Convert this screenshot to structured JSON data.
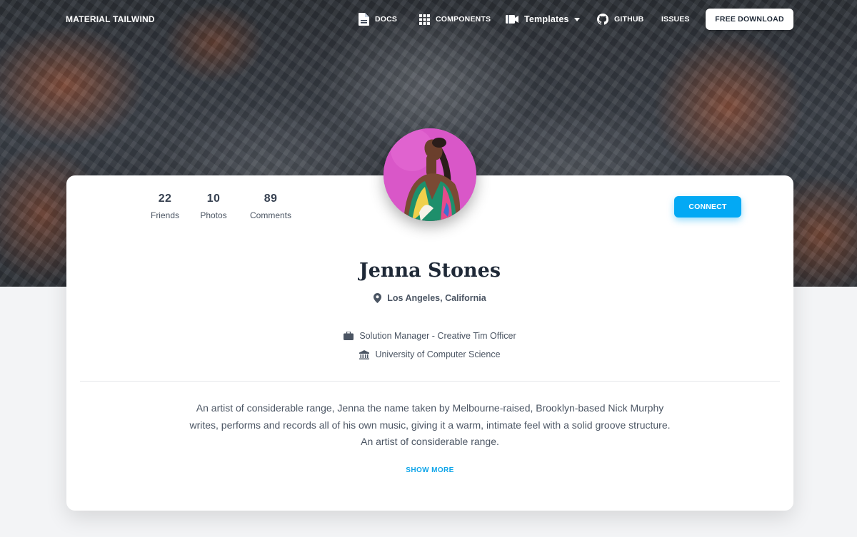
{
  "nav": {
    "brand": "MATERIAL TAILWIND",
    "docs": "DOCS",
    "components": "COMPONENTS",
    "templates": "Templates",
    "github": "GITHUB",
    "issues": "ISSUES",
    "download": "FREE DOWNLOAD"
  },
  "profile": {
    "stats": [
      {
        "value": "22",
        "label": "Friends"
      },
      {
        "value": "10",
        "label": "Photos"
      },
      {
        "value": "89",
        "label": "Comments"
      }
    ],
    "connect_label": "CONNECT",
    "name": "Jenna Stones",
    "location": "Los Angeles, California",
    "job": "Solution Manager - Creative Tim Officer",
    "school": "University of Computer Science",
    "bio_lines": [
      "An artist of considerable range, Jenna the name taken by Melbourne-raised, Brooklyn-based Nick Murphy",
      "writes, performs and records all of his own music, giving it a warm, intimate feel with a solid groove structure.",
      "An artist of considerable range."
    ],
    "show_more": "SHOW MORE"
  },
  "colors": {
    "accent": "#03a9f4",
    "link": "#0ea5e9",
    "avatar_bg": "#d957c8"
  },
  "icons": [
    "file-icon",
    "grid-icon",
    "video-icon",
    "caret-down-icon",
    "github-icon",
    "map-pin-icon",
    "briefcase-icon",
    "university-icon"
  ]
}
